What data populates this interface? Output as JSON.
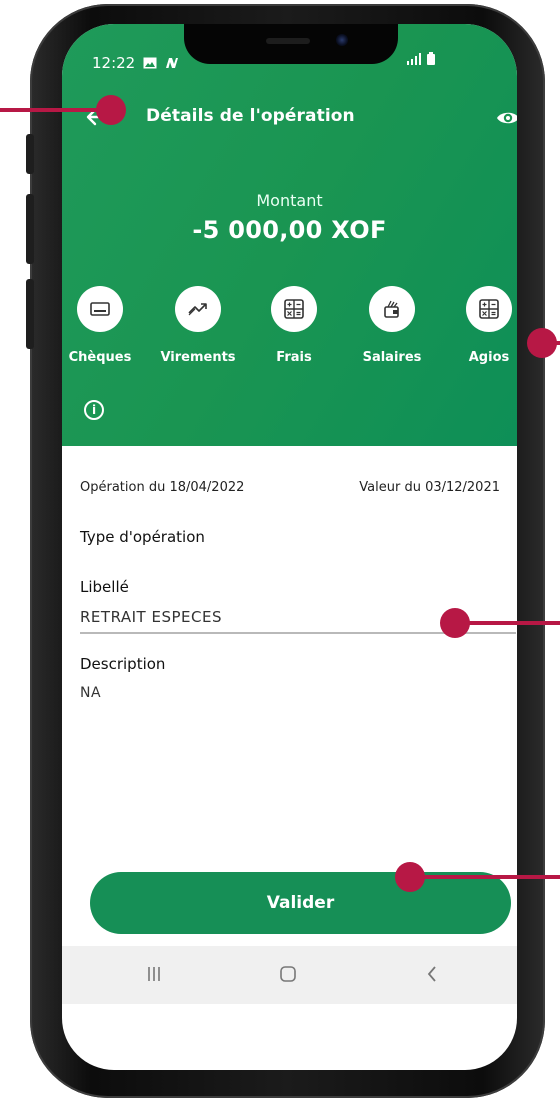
{
  "status_bar": {
    "time": "12:22"
  },
  "header": {
    "title": "Détails de l'opération",
    "amount_label": "Montant",
    "amount": "-5 000,00 XOF"
  },
  "categories": [
    {
      "label": "Chèques",
      "icon": "card-icon"
    },
    {
      "label": "Virements",
      "icon": "transfer-icon"
    },
    {
      "label": "Frais",
      "icon": "calculator-icon"
    },
    {
      "label": "Salaires",
      "icon": "wallet-icon"
    },
    {
      "label": "Agios",
      "icon": "calculator-icon"
    }
  ],
  "details": {
    "operation_date": "Opération du 18/04/2022",
    "value_date": "Valeur du 03/12/2021",
    "type_label": "Type d'opération",
    "libelle_label": "Libellé",
    "libelle_value": "RETRAIT ESPECES",
    "description_label": "Description",
    "description_value": "NA"
  },
  "actions": {
    "validate": "Valider"
  },
  "colors": {
    "primary_green": "#1a9552",
    "button_green": "#168f56",
    "callout": "#b71845"
  }
}
